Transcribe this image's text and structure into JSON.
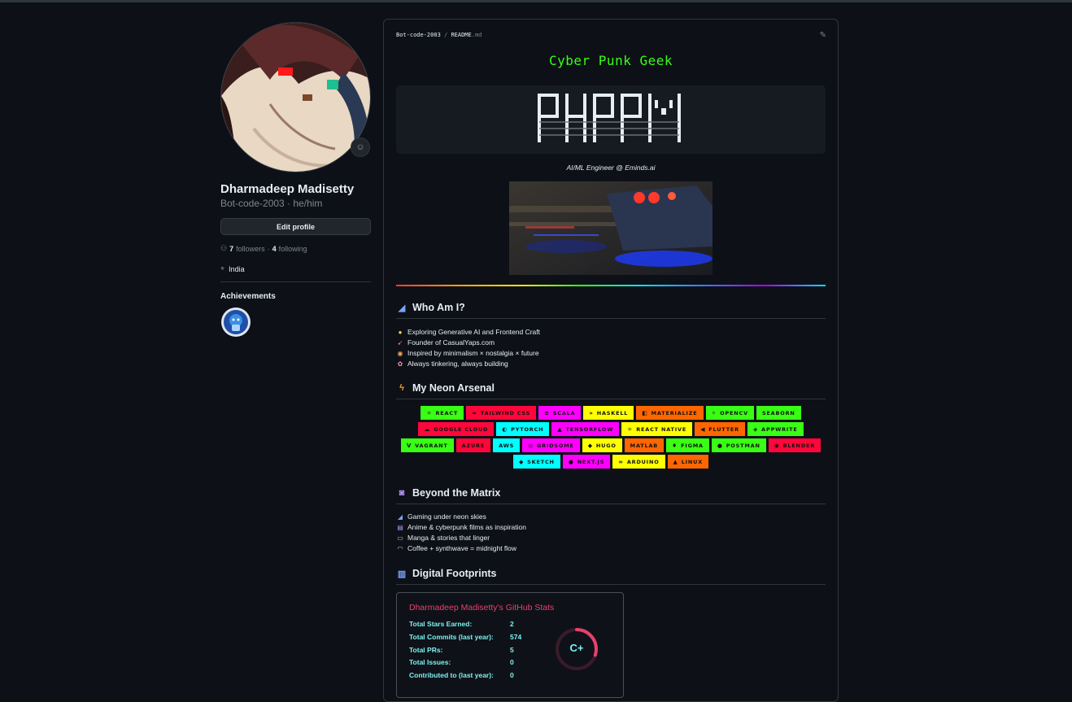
{
  "profile": {
    "name": "Dharmadeep Madisetty",
    "login_pronouns": "Bot-code-2003 · he/him",
    "edit_profile_label": "Edit profile",
    "followers_count": "7",
    "followers_label": "followers",
    "separator": "·",
    "following_count": "4",
    "following_label": "following",
    "location": "India",
    "achievements_label": "Achievements"
  },
  "readme": {
    "path_user": "Bot-code-2003",
    "path_sep": "/",
    "path_file": "README",
    "path_ext": ".md",
    "title": "Cyber Punk Geek",
    "subtitle": "AI/ML Engineer @ Eminds.ai",
    "sections": {
      "who": {
        "heading": "Who Am I?",
        "items": [
          "Exploring Generative AI and Frontend Craft",
          "Founder of CasualYaps.com",
          "Inspired by minimalism × nostalgia × future",
          "Always tinkering, always building"
        ]
      },
      "arsenal": {
        "heading": "My Neon Arsenal"
      },
      "beyond": {
        "heading": "Beyond the Matrix",
        "items": [
          "Gaming under neon skies",
          "Anime & cyberpunk films as inspiration",
          "Manga & stories that linger",
          "Coffee + synthwave = midnight flow"
        ]
      },
      "footprints": {
        "heading": "Digital Footprints"
      }
    },
    "tech_badges": [
      {
        "label": "REACT",
        "color": "#39ff14"
      },
      {
        "label": "TAILWIND CSS",
        "color": "#ff073a"
      },
      {
        "label": "SCALA",
        "color": "#ff00ff"
      },
      {
        "label": "HASKELL",
        "color": "#ffff00"
      },
      {
        "label": "MATERIALIZE",
        "color": "#ff6600"
      },
      {
        "label": "OPENCV",
        "color": "#39ff14"
      },
      {
        "label": "SEABORN",
        "color": "#39ff14"
      },
      {
        "label": "GOOGLE CLOUD",
        "color": "#ff073a"
      },
      {
        "label": "PYTORCH",
        "color": "#00ffff"
      },
      {
        "label": "TENSORFLOW",
        "color": "#ff00ff"
      },
      {
        "label": "REACT NATIVE",
        "color": "#ffff00"
      },
      {
        "label": "FLUTTER",
        "color": "#ff6600"
      },
      {
        "label": "APPWRITE",
        "color": "#39ff14"
      },
      {
        "label": "VAGRANT",
        "color": "#39ff14"
      },
      {
        "label": "AZURE",
        "color": "#ff073a"
      },
      {
        "label": "AWS",
        "color": "#00ffff"
      },
      {
        "label": "GRIDSOME",
        "color": "#ff00ff"
      },
      {
        "label": "HUGO",
        "color": "#ffff00"
      },
      {
        "label": "MATLAB",
        "color": "#ff6600"
      },
      {
        "label": "FIGMA",
        "color": "#39ff14"
      },
      {
        "label": "POSTMAN",
        "color": "#39ff14"
      },
      {
        "label": "BLENDER",
        "color": "#ff073a"
      },
      {
        "label": "SKETCH",
        "color": "#00ffff"
      },
      {
        "label": "NEXT.JS",
        "color": "#ff00ff"
      },
      {
        "label": "ARDUINO",
        "color": "#ffff00"
      },
      {
        "label": "LINUX",
        "color": "#ff6600"
      }
    ],
    "stats": {
      "title": "Dharmadeep Madisetty's GitHub Stats",
      "rows": [
        {
          "label": "Total Stars Earned:",
          "value": "2"
        },
        {
          "label": "Total Commits (last year):",
          "value": "574"
        },
        {
          "label": "Total PRs:",
          "value": "5"
        },
        {
          "label": "Total Issues:",
          "value": "0"
        },
        {
          "label": "Contributed to (last year):",
          "value": "0"
        }
      ],
      "grade": "C+",
      "grade_fraction": 0.3
    }
  }
}
